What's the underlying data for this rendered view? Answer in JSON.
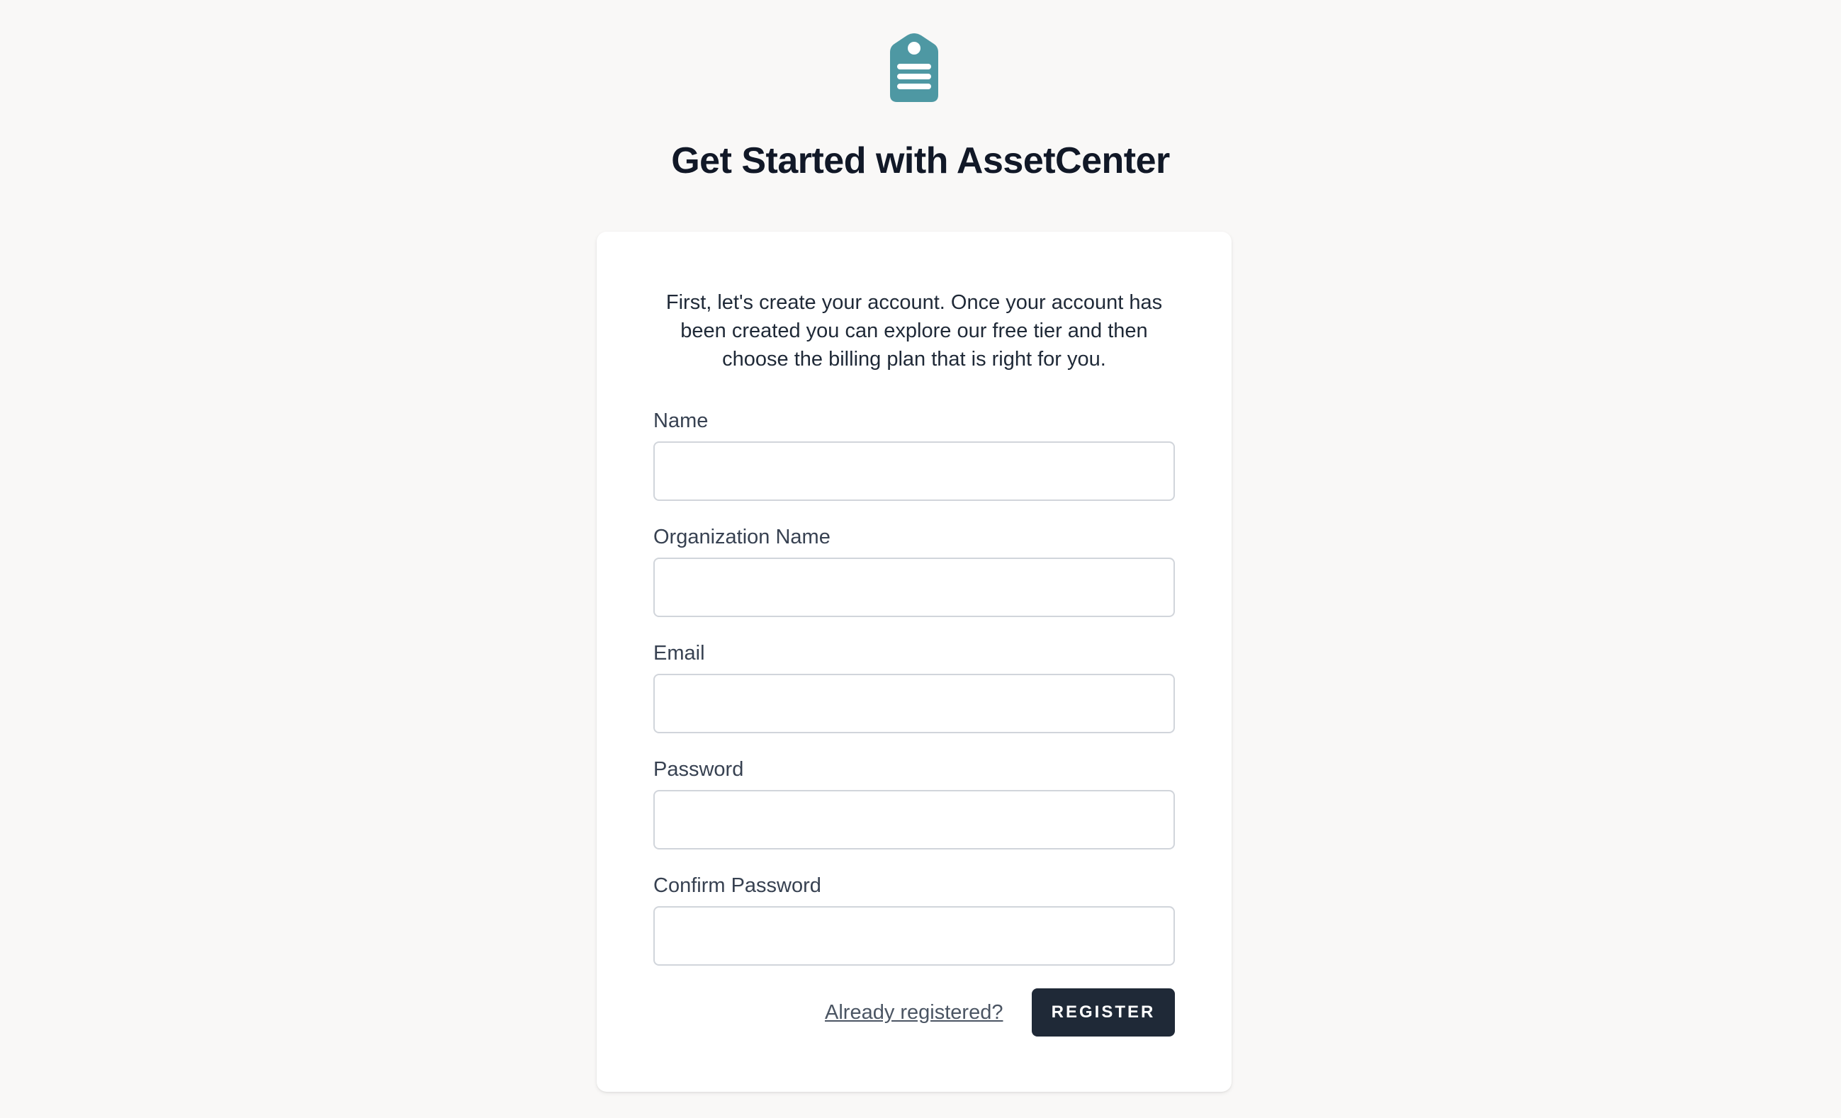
{
  "brand": {
    "logo_icon": "asset-tag-icon",
    "accent_color": "#4e98a3"
  },
  "header": {
    "title": "Get Started with AssetCenter"
  },
  "card": {
    "intro": "First, let's create your account. Once your account has been created you can explore our free tier and then choose the billing plan that is right for you."
  },
  "form": {
    "fields": [
      {
        "label": "Name",
        "value": "",
        "placeholder": ""
      },
      {
        "label": "Organization Name",
        "value": "",
        "placeholder": ""
      },
      {
        "label": "Email",
        "value": "",
        "placeholder": ""
      },
      {
        "label": "Password",
        "value": "",
        "placeholder": ""
      },
      {
        "label": "Confirm Password",
        "value": "",
        "placeholder": ""
      }
    ],
    "login_link": "Already registered?",
    "submit_label": "REGISTER"
  }
}
